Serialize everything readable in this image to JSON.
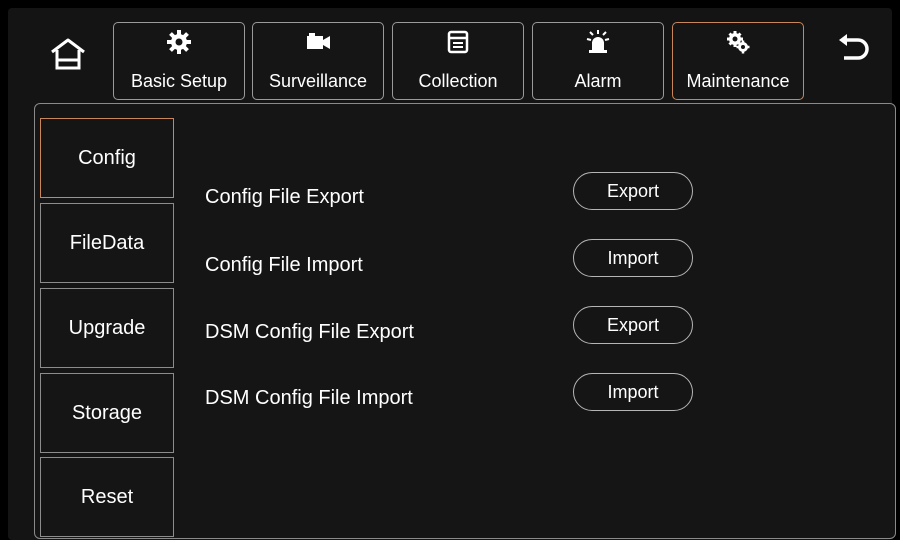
{
  "nav": {
    "home_icon": "home-icon",
    "back_icon": "back-arrow-icon",
    "tabs": [
      {
        "label": "Basic Setup",
        "icon": "gear-icon"
      },
      {
        "label": "Surveillance",
        "icon": "camera-icon"
      },
      {
        "label": "Collection",
        "icon": "window-icon"
      },
      {
        "label": "Alarm",
        "icon": "alarm-light-icon"
      },
      {
        "label": "Maintenance",
        "icon": "gears-icon",
        "active": true
      }
    ]
  },
  "sidebar": {
    "items": [
      {
        "label": "Config",
        "active": true
      },
      {
        "label": "FileData"
      },
      {
        "label": "Upgrade"
      },
      {
        "label": "Storage"
      },
      {
        "label": "Reset"
      }
    ]
  },
  "main": {
    "rows": [
      {
        "label": "Config File Export",
        "button": "Export"
      },
      {
        "label": "Config File Import",
        "button": "Import"
      },
      {
        "label": "DSM Config File Export",
        "button": "Export"
      },
      {
        "label": "DSM Config File Import",
        "button": "Import"
      }
    ]
  },
  "colors": {
    "active_border": "#c8865a",
    "border": "#8c8c8c",
    "background": "#151515"
  }
}
